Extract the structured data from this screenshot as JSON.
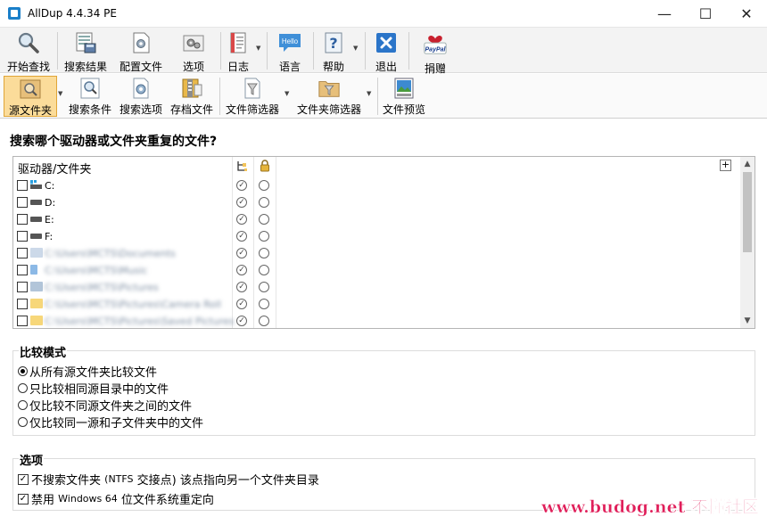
{
  "window": {
    "title": "AllDup 4.4.34 PE",
    "minimize": "—",
    "maximize": "☐",
    "close": "✕"
  },
  "toolbar_main": {
    "items": [
      {
        "label": "开始查找",
        "icon": "magnifier-icon"
      },
      {
        "label": "搜索结果",
        "icon": "results-icon"
      },
      {
        "label": "配置文件",
        "icon": "profile-icon"
      },
      {
        "label": "选项",
        "icon": "options-icon"
      },
      {
        "label": "日志",
        "icon": "log-icon"
      },
      {
        "label": "语言",
        "icon": "hello-icon",
        "icon_text": "Hello"
      },
      {
        "label": "帮助",
        "icon": "help-icon"
      },
      {
        "label": "退出",
        "icon": "exit-icon"
      },
      {
        "label": "捐赠",
        "icon": "paypal-icon",
        "icon_text": "PayPal"
      }
    ]
  },
  "toolbar_secondary": {
    "items": [
      {
        "label": "源文件夹",
        "active": true
      },
      {
        "label": "搜索条件"
      },
      {
        "label": "搜索选项"
      },
      {
        "label": "存档文件"
      },
      {
        "label": "文件筛选器"
      },
      {
        "label": "文件夹筛选器"
      },
      {
        "label": "文件预览"
      }
    ]
  },
  "question": "搜索哪个驱动器或文件夹重复的文件?",
  "drive_list": {
    "header": "驱动器/文件夹",
    "rows": [
      {
        "label": "C:",
        "kind": "system-drive",
        "blurred": false
      },
      {
        "label": "D:",
        "kind": "drive",
        "blurred": false
      },
      {
        "label": "E:",
        "kind": "drive",
        "blurred": false
      },
      {
        "label": "F:",
        "kind": "drive",
        "blurred": false
      },
      {
        "label": "C:\\Users\\MCTS\\Documents",
        "kind": "folder",
        "blurred": true
      },
      {
        "label": "C:\\Users\\MCTS\\Music",
        "kind": "music",
        "blurred": true
      },
      {
        "label": "C:\\Users\\MCTS\\Pictures",
        "kind": "pictures",
        "blurred": true
      },
      {
        "label": "C:\\Users\\MCTS\\Pictures\\Camera Roll",
        "kind": "folder",
        "blurred": true
      },
      {
        "label": "C:\\Users\\MCTS\\Pictures\\Saved Pictures",
        "kind": "folder",
        "blurred": true
      }
    ]
  },
  "compare_mode": {
    "title": "比较模式",
    "options": [
      {
        "label": "从所有源文件夹比较文件",
        "selected": true
      },
      {
        "label": "只比较相同源目录中的文件",
        "selected": false
      },
      {
        "label": "仅比较不同源文件夹之间的文件",
        "selected": false
      },
      {
        "label": "仅比较同一源和子文件夹中的文件",
        "selected": false
      }
    ]
  },
  "options_group": {
    "title": "选项",
    "opt1_pre": "不搜索文件夹",
    "opt1_latin": "(NTFS",
    "opt1_post": "交接点) 该点指向另一个文件夹目录",
    "opt2_pre": "禁用",
    "opt2_latin": "Windows 64",
    "opt2_post": "位文件系统重定向"
  },
  "watermark": "www.budog.net 不懂社区",
  "colors": {
    "active_tab_bg": "#fbdc9a",
    "active_tab_border": "#e0a538",
    "watermark": "#e01f5a"
  }
}
